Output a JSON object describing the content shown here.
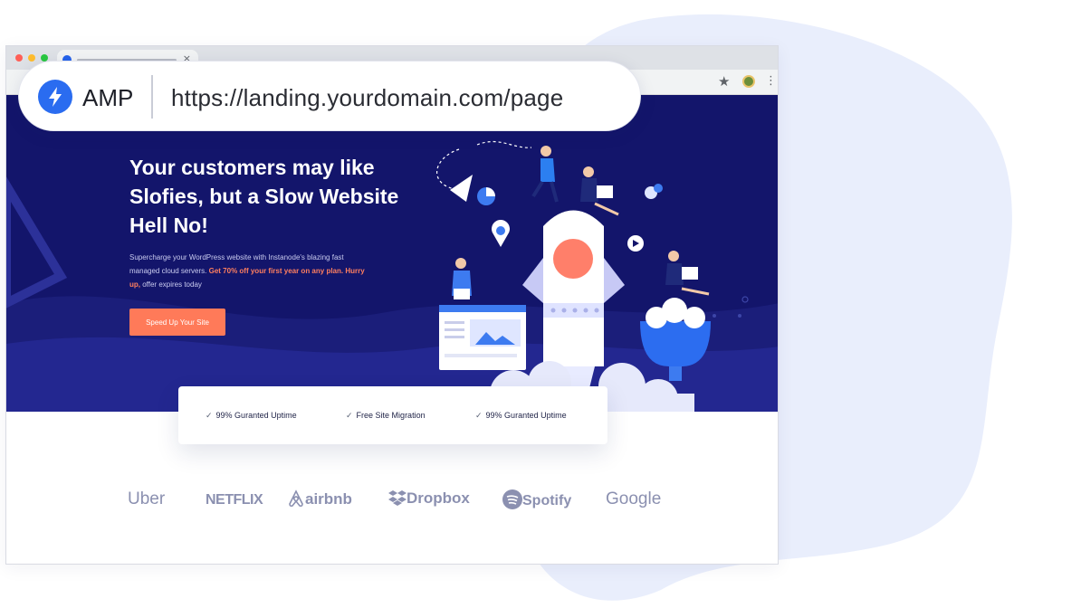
{
  "colors": {
    "background_blob": "#e9eefc",
    "hero_bg": "#13156b",
    "accent": "#ff7a59",
    "amp_blue": "#2a6cf0"
  },
  "browser": {
    "tab_icons": {
      "close": "close-icon"
    },
    "toolbar_icons": [
      "star-icon",
      "profile-avatar",
      "more-vert-icon"
    ]
  },
  "urlbar": {
    "badge_icon": "lightning-bolt-icon",
    "badge_label": "AMP",
    "url": "https://landing.yourdomain.com/page"
  },
  "hero": {
    "headline": "Your customers may like Slofies, but a Slow Website Hell No!",
    "subcopy_before": "Supercharge your WordPress website with Instanode's blazing fast managed cloud servers.",
    "subcopy_highlight1": "Get 70% off your first year on any plan.",
    "subcopy_highlight2": "Hurry up,",
    "subcopy_after": "offer expires today",
    "cta_label": "Speed Up Your Site"
  },
  "features": [
    {
      "icon": "check-icon",
      "label": "99% Guranted Uptime"
    },
    {
      "icon": "check-icon",
      "label": "Free Site Migration"
    },
    {
      "icon": "check-icon",
      "label": "99% Guranted Uptime"
    }
  ],
  "logos": [
    {
      "name": "Uber"
    },
    {
      "name": "NETFLIX"
    },
    {
      "name": "airbnb",
      "icon": "airbnb-icon"
    },
    {
      "name": "Dropbox",
      "icon": "dropbox-icon"
    },
    {
      "name": "Spotify",
      "icon": "spotify-icon"
    },
    {
      "name": "Google"
    }
  ]
}
